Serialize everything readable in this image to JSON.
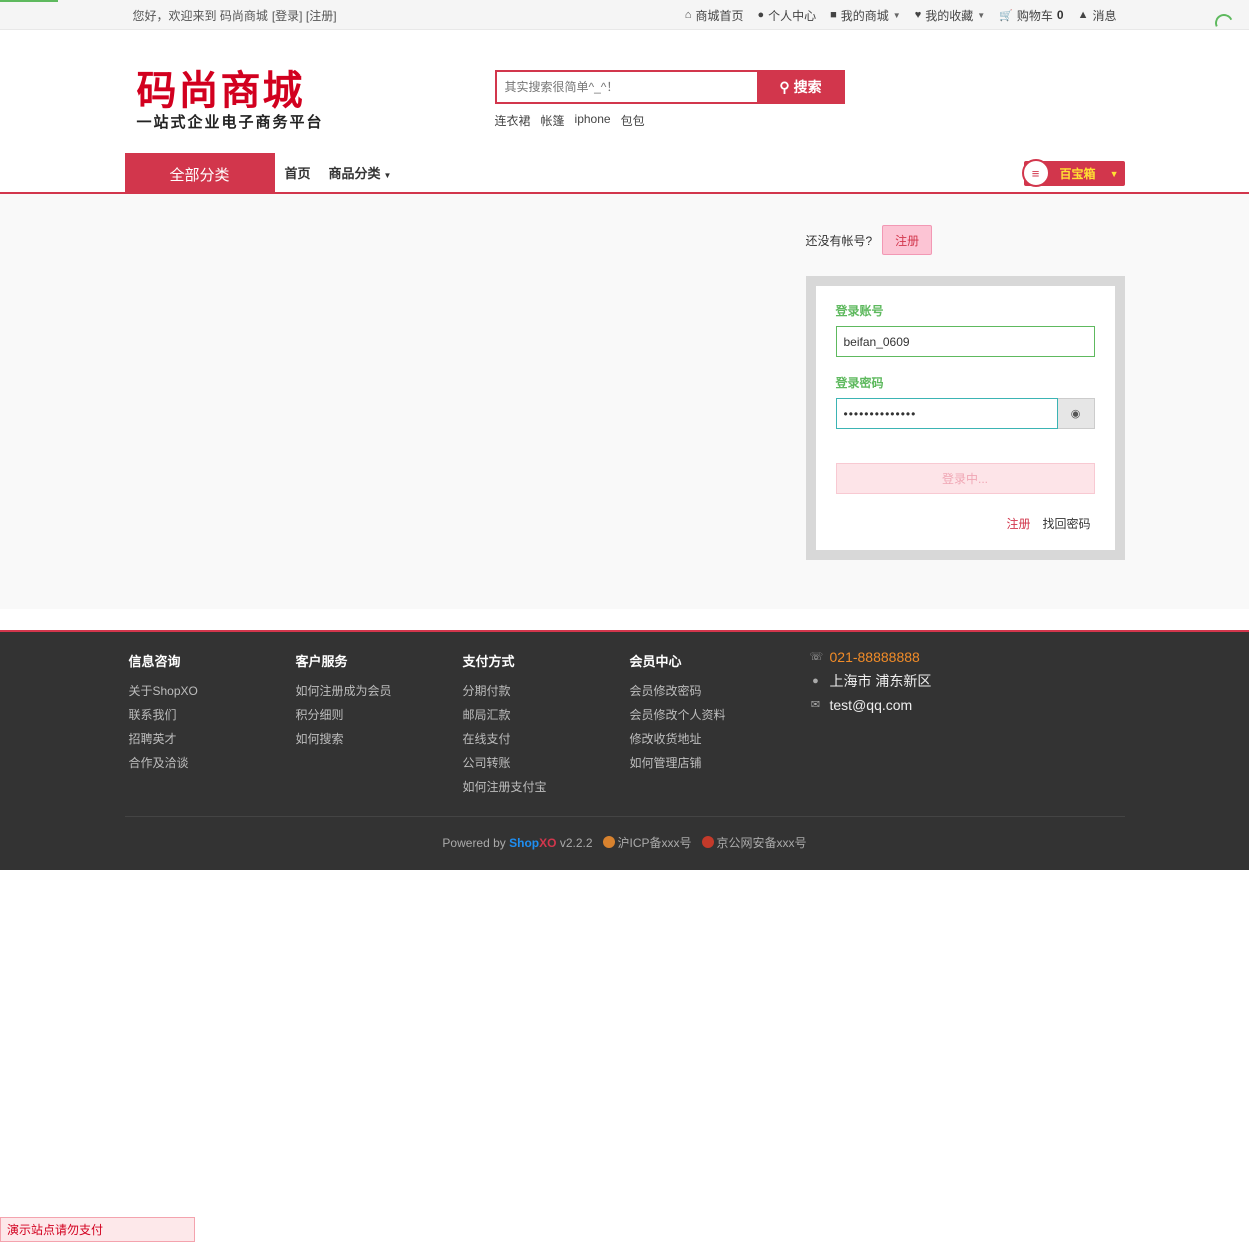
{
  "topbar": {
    "welcome": "您好，欢迎来到 码尚商城",
    "login_link": "[登录]",
    "register_link": "[注册]",
    "nav": [
      {
        "label": "商城首页",
        "icon": "home-icon"
      },
      {
        "label": "个人中心",
        "icon": "user-icon"
      },
      {
        "label": "我的商城",
        "icon": "cube-icon"
      },
      {
        "label": "我的收藏",
        "icon": "heart-icon"
      },
      {
        "label": "购物车",
        "icon": "cart-icon"
      },
      {
        "label": "消息",
        "icon": "bell-icon"
      }
    ],
    "cart_count": "0"
  },
  "header": {
    "logo_main": "码尚商城",
    "logo_sub": "一站式企业电子商务平台",
    "search_placeholder": "其实搜索很简单^_^！",
    "search_button": "搜索",
    "hot_words": [
      "连衣裙",
      "帐篷",
      "iphone",
      "包包"
    ]
  },
  "navbar": {
    "all_categories": "全部分类",
    "links": [
      "首页",
      "商品分类"
    ],
    "treasure": "百宝箱"
  },
  "login": {
    "no_account_tip": "还没有帐号?",
    "register_button": "注册",
    "account_label": "登录账号",
    "account_value": "beifan_0609",
    "password_label": "登录密码",
    "password_value": "••••••••••••••",
    "submit_button": "登录中...",
    "link_register": "注册",
    "link_find_password": "找回密码"
  },
  "footer": {
    "columns": [
      {
        "title": "信息咨询",
        "links": [
          "关于ShopXO",
          "联系我们",
          "招聘英才",
          "合作及洽谈"
        ]
      },
      {
        "title": "客户服务",
        "links": [
          "如何注册成为会员",
          "积分细则",
          "如何搜索"
        ]
      },
      {
        "title": "支付方式",
        "links": [
          "分期付款",
          "邮局汇款",
          "在线支付",
          "公司转账",
          "如何注册支付宝"
        ]
      },
      {
        "title": "会员中心",
        "links": [
          "会员修改密码",
          "会员修改个人资料",
          "修改收货地址",
          "如何管理店铺"
        ]
      }
    ],
    "contact": {
      "phone": "021-88888888",
      "address": "上海市 浦东新区",
      "email": "test@qq.com"
    },
    "copyright": {
      "powered_by": "Powered by",
      "brand_shop": "Shop",
      "brand_xo": "XO",
      "version": "v2.2.2",
      "icp": "沪ICP备xxx号",
      "police": "京公网安备xxx号"
    }
  },
  "demo_tip": "演示站点请勿支付",
  "colors": {
    "accent": "#d2364c",
    "success": "#5eb95e",
    "footer_bg": "#333333"
  }
}
